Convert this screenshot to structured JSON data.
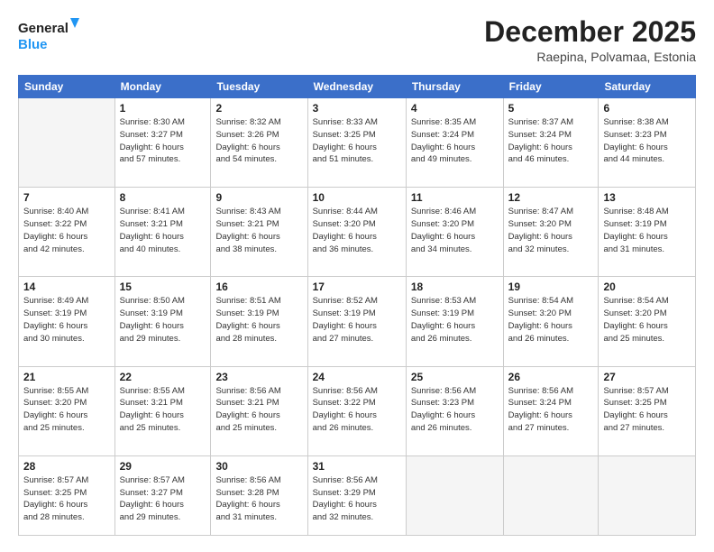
{
  "logo": {
    "line1": "General",
    "line2": "Blue"
  },
  "header": {
    "month": "December 2025",
    "location": "Raepina, Polvamaa, Estonia"
  },
  "weekdays": [
    "Sunday",
    "Monday",
    "Tuesday",
    "Wednesday",
    "Thursday",
    "Friday",
    "Saturday"
  ],
  "weeks": [
    [
      {
        "day": "",
        "info": ""
      },
      {
        "day": "1",
        "info": "Sunrise: 8:30 AM\nSunset: 3:27 PM\nDaylight: 6 hours\nand 57 minutes."
      },
      {
        "day": "2",
        "info": "Sunrise: 8:32 AM\nSunset: 3:26 PM\nDaylight: 6 hours\nand 54 minutes."
      },
      {
        "day": "3",
        "info": "Sunrise: 8:33 AM\nSunset: 3:25 PM\nDaylight: 6 hours\nand 51 minutes."
      },
      {
        "day": "4",
        "info": "Sunrise: 8:35 AM\nSunset: 3:24 PM\nDaylight: 6 hours\nand 49 minutes."
      },
      {
        "day": "5",
        "info": "Sunrise: 8:37 AM\nSunset: 3:24 PM\nDaylight: 6 hours\nand 46 minutes."
      },
      {
        "day": "6",
        "info": "Sunrise: 8:38 AM\nSunset: 3:23 PM\nDaylight: 6 hours\nand 44 minutes."
      }
    ],
    [
      {
        "day": "7",
        "info": "Sunrise: 8:40 AM\nSunset: 3:22 PM\nDaylight: 6 hours\nand 42 minutes."
      },
      {
        "day": "8",
        "info": "Sunrise: 8:41 AM\nSunset: 3:21 PM\nDaylight: 6 hours\nand 40 minutes."
      },
      {
        "day": "9",
        "info": "Sunrise: 8:43 AM\nSunset: 3:21 PM\nDaylight: 6 hours\nand 38 minutes."
      },
      {
        "day": "10",
        "info": "Sunrise: 8:44 AM\nSunset: 3:20 PM\nDaylight: 6 hours\nand 36 minutes."
      },
      {
        "day": "11",
        "info": "Sunrise: 8:46 AM\nSunset: 3:20 PM\nDaylight: 6 hours\nand 34 minutes."
      },
      {
        "day": "12",
        "info": "Sunrise: 8:47 AM\nSunset: 3:20 PM\nDaylight: 6 hours\nand 32 minutes."
      },
      {
        "day": "13",
        "info": "Sunrise: 8:48 AM\nSunset: 3:19 PM\nDaylight: 6 hours\nand 31 minutes."
      }
    ],
    [
      {
        "day": "14",
        "info": "Sunrise: 8:49 AM\nSunset: 3:19 PM\nDaylight: 6 hours\nand 30 minutes."
      },
      {
        "day": "15",
        "info": "Sunrise: 8:50 AM\nSunset: 3:19 PM\nDaylight: 6 hours\nand 29 minutes."
      },
      {
        "day": "16",
        "info": "Sunrise: 8:51 AM\nSunset: 3:19 PM\nDaylight: 6 hours\nand 28 minutes."
      },
      {
        "day": "17",
        "info": "Sunrise: 8:52 AM\nSunset: 3:19 PM\nDaylight: 6 hours\nand 27 minutes."
      },
      {
        "day": "18",
        "info": "Sunrise: 8:53 AM\nSunset: 3:19 PM\nDaylight: 6 hours\nand 26 minutes."
      },
      {
        "day": "19",
        "info": "Sunrise: 8:54 AM\nSunset: 3:20 PM\nDaylight: 6 hours\nand 26 minutes."
      },
      {
        "day": "20",
        "info": "Sunrise: 8:54 AM\nSunset: 3:20 PM\nDaylight: 6 hours\nand 25 minutes."
      }
    ],
    [
      {
        "day": "21",
        "info": "Sunrise: 8:55 AM\nSunset: 3:20 PM\nDaylight: 6 hours\nand 25 minutes."
      },
      {
        "day": "22",
        "info": "Sunrise: 8:55 AM\nSunset: 3:21 PM\nDaylight: 6 hours\nand 25 minutes."
      },
      {
        "day": "23",
        "info": "Sunrise: 8:56 AM\nSunset: 3:21 PM\nDaylight: 6 hours\nand 25 minutes."
      },
      {
        "day": "24",
        "info": "Sunrise: 8:56 AM\nSunset: 3:22 PM\nDaylight: 6 hours\nand 26 minutes."
      },
      {
        "day": "25",
        "info": "Sunrise: 8:56 AM\nSunset: 3:23 PM\nDaylight: 6 hours\nand 26 minutes."
      },
      {
        "day": "26",
        "info": "Sunrise: 8:56 AM\nSunset: 3:24 PM\nDaylight: 6 hours\nand 27 minutes."
      },
      {
        "day": "27",
        "info": "Sunrise: 8:57 AM\nSunset: 3:25 PM\nDaylight: 6 hours\nand 27 minutes."
      }
    ],
    [
      {
        "day": "28",
        "info": "Sunrise: 8:57 AM\nSunset: 3:25 PM\nDaylight: 6 hours\nand 28 minutes."
      },
      {
        "day": "29",
        "info": "Sunrise: 8:57 AM\nSunset: 3:27 PM\nDaylight: 6 hours\nand 29 minutes."
      },
      {
        "day": "30",
        "info": "Sunrise: 8:56 AM\nSunset: 3:28 PM\nDaylight: 6 hours\nand 31 minutes."
      },
      {
        "day": "31",
        "info": "Sunrise: 8:56 AM\nSunset: 3:29 PM\nDaylight: 6 hours\nand 32 minutes."
      },
      {
        "day": "",
        "info": ""
      },
      {
        "day": "",
        "info": ""
      },
      {
        "day": "",
        "info": ""
      }
    ]
  ]
}
